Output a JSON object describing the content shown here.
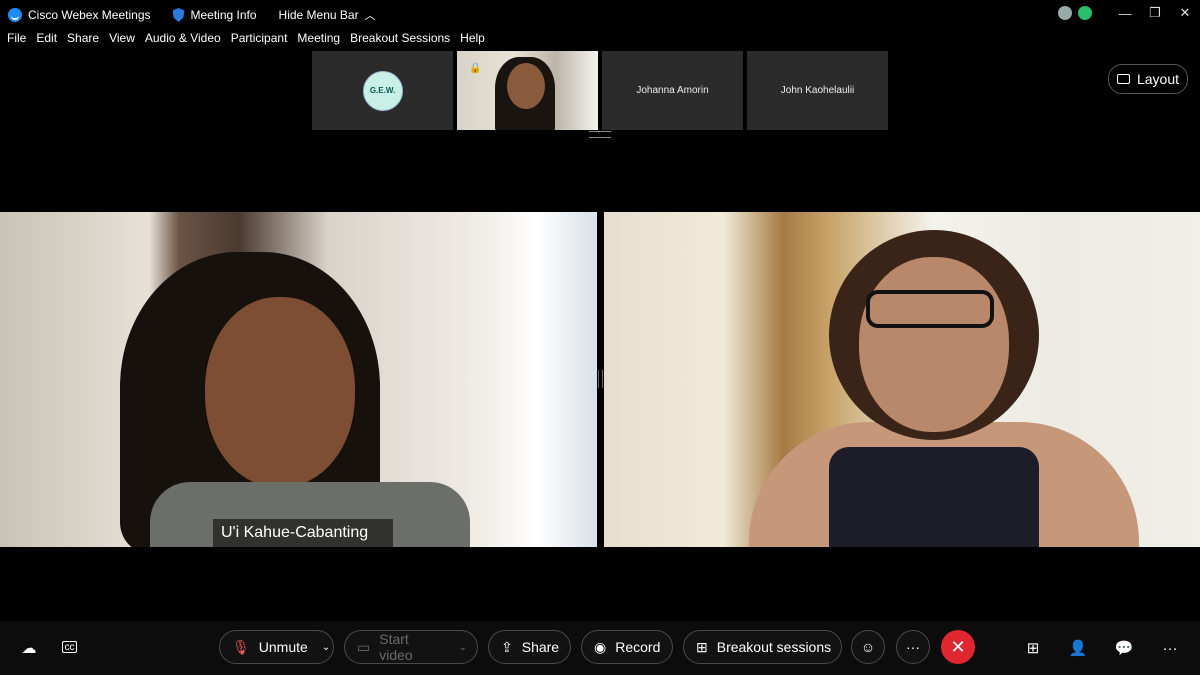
{
  "app": {
    "title": "Cisco Webex Meetings",
    "meeting_info": "Meeting Info",
    "hide_menu_bar": "Hide Menu Bar",
    "hide_menu_bar_icon": "chevron-up-icon",
    "logo_icon": "webex-logo-icon",
    "meeting_info_icon": "shield-icon"
  },
  "window_controls": {
    "minimize": "—",
    "restore": "❐",
    "close": "✕"
  },
  "menu": {
    "items": [
      "File",
      "Edit",
      "Share",
      "View",
      "Audio & Video",
      "Participant",
      "Meeting",
      "Breakout Sessions",
      "Help"
    ]
  },
  "thumbnails": [
    {
      "type": "logo",
      "logo_text": "G.E.W."
    },
    {
      "type": "video",
      "locked": true
    },
    {
      "type": "name",
      "name": "Johanna Amorin"
    },
    {
      "type": "name",
      "name": "John Kaohelaulii"
    }
  ],
  "layout_button": {
    "label": "Layout",
    "icon": "layout-icon"
  },
  "main_videos": [
    {
      "name_tag": "U'i Kahue-Cabanting"
    },
    {
      "name_tag": ""
    }
  ],
  "toolbar": {
    "unmute": "Unmute",
    "start_video": "Start video",
    "share": "Share",
    "record": "Record",
    "breakout": "Breakout sessions",
    "more": "···",
    "end": "✕"
  },
  "colors": {
    "end_button": "#e0262f",
    "accent": "#1d8cf8"
  }
}
